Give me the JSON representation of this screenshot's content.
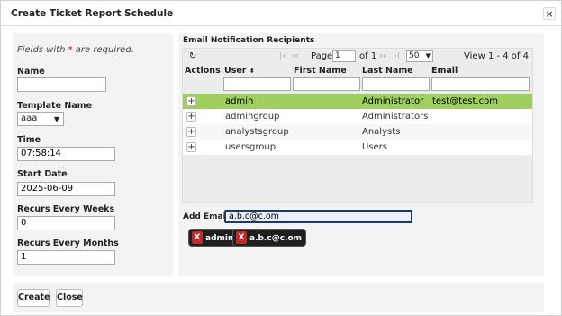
{
  "dialog": {
    "title": "Create Ticket Report Schedule",
    "close_glyph": "×"
  },
  "form": {
    "hint_prefix": "Fields with ",
    "hint_star": "*",
    "hint_suffix": " are required.",
    "name_label": "Name",
    "name_value": "",
    "template_label": "Template Name",
    "template_value": "aaa",
    "time_label": "Time",
    "time_value": "07:58:14",
    "start_label": "Start Date",
    "start_value": "2025-06-09",
    "weeks_label": "Recurs Every Weeks",
    "weeks_value": "0",
    "months_label": "Recurs Every Months",
    "months_value": "1"
  },
  "recipients": {
    "section_title": "Email Notification Recipients",
    "pager": {
      "refresh_glyph": "↻",
      "first": "|◃",
      "prev": "◃◃",
      "page_label": "Page",
      "page_value": "1",
      "of_label": "of 1",
      "next": "▹▹",
      "last": "▹|",
      "rows_value": "50",
      "view_text": "View 1 - 4 of 4"
    },
    "columns": [
      "Actions",
      "User",
      "First Name",
      "Last Name",
      "Email"
    ],
    "sort_glyph": "⬍",
    "rows": [
      {
        "user": "admin",
        "first": "",
        "last": "Administrator",
        "email": "test@test.com",
        "selected": true
      },
      {
        "user": "admingroup",
        "first": "",
        "last": "Administrators",
        "email": "",
        "selected": false
      },
      {
        "user": "analystsgroup",
        "first": "",
        "last": "Analysts",
        "email": "",
        "selected": false
      },
      {
        "user": "usersgroup",
        "first": "",
        "last": "Users",
        "email": "",
        "selected": false
      }
    ],
    "add_label": "Add Email(s)",
    "add_value": "a.b.c@c.om",
    "chips": [
      {
        "x": "X",
        "label": "admin"
      },
      {
        "x": "X",
        "label": "a.b.c@c.om"
      }
    ]
  },
  "footer": {
    "create_label": "Create",
    "close_label": "Close"
  },
  "colors": {
    "selected_row": "#9ecf5f",
    "chip_bg": "#1f1f1f",
    "chip_x": "#c62828",
    "required_star": "#dd0000"
  }
}
